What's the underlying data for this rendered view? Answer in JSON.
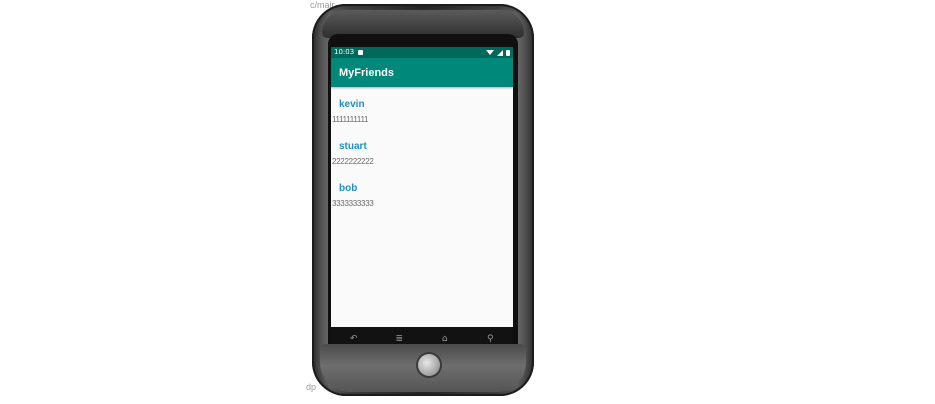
{
  "background": {
    "top_text": "c/mair",
    "bottom_text": "dp"
  },
  "status_bar": {
    "time": "10:03",
    "icons": [
      "sd-card-icon",
      "wifi-icon",
      "signal-icon",
      "battery-icon"
    ]
  },
  "app_bar": {
    "title": "MyFriends",
    "color": "#00897b"
  },
  "friends": [
    {
      "name": "kevin",
      "phone": "1111111111"
    },
    {
      "name": "stuart",
      "phone": "2222222222"
    },
    {
      "name": "bob",
      "phone": "3333333333"
    }
  ],
  "nav_bar": {
    "back_icon": "↶",
    "menu_icon": "≣",
    "home_icon": "⌂",
    "search_icon": "⚲"
  },
  "colors": {
    "accent": "#00897b",
    "status": "#00695c",
    "name_text": "#1e90c8"
  }
}
